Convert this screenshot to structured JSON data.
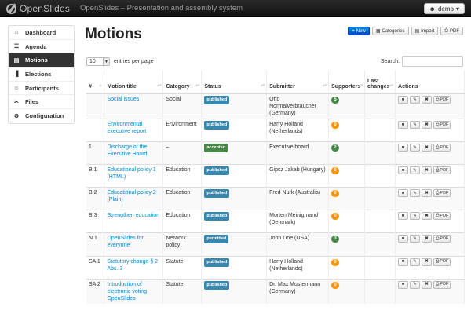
{
  "app": {
    "brand": "OpenSlides",
    "subtitle": "OpenSlides – Presentation and assembly system",
    "user": "demo"
  },
  "sidebar": {
    "items": [
      {
        "label": "Dashboard",
        "icon": "home-icon",
        "glyph": "⌂",
        "active": false
      },
      {
        "label": "Agenda",
        "icon": "list-icon",
        "glyph": "☰",
        "active": false
      },
      {
        "label": "Motions",
        "icon": "file-icon",
        "glyph": "▤",
        "active": true
      },
      {
        "label": "Elections",
        "icon": "bar-chart-icon",
        "glyph": "▐",
        "active": false
      },
      {
        "label": "Participants",
        "icon": "user-icon",
        "glyph": "☺",
        "active": false
      },
      {
        "label": "Files",
        "icon": "paperclip-icon",
        "glyph": "✂",
        "active": false
      },
      {
        "label": "Configuration",
        "icon": "gear-icon",
        "glyph": "⚙",
        "active": false
      }
    ]
  },
  "main": {
    "title": "Motions",
    "toolbar": {
      "new": "New",
      "categories": "Categories",
      "import": "Import",
      "pdf": "PDF"
    },
    "length": {
      "value": "10",
      "label": "entries per page"
    },
    "search": {
      "label": "Search:",
      "value": ""
    },
    "columns": [
      "#",
      "Motion title",
      "Category",
      "Status",
      "Submitter",
      "Supporters",
      "Last changes",
      "Actions"
    ],
    "rows": [
      {
        "num": "",
        "title": "Social issues",
        "category": "Social",
        "status": "published",
        "submitter": "Otto Normalverbraucher (Germany)",
        "supporters": "5",
        "sup_color": "green"
      },
      {
        "num": "",
        "title": "Environmental executive report",
        "category": "Environment",
        "status": "published",
        "submitter": "Harry Holland (Netherlands)",
        "supporters": "0",
        "sup_color": "orange"
      },
      {
        "num": "1",
        "title": "Discharge of the Executive Board",
        "category": "–",
        "status": "accepted",
        "submitter": "Executive board",
        "supporters": "2",
        "sup_color": "green"
      },
      {
        "num": "B 1",
        "title": "Educational policy 1 (HTML)",
        "category": "Education",
        "status": "published",
        "submitter": "Gipsz Jakab (Hungary)",
        "supporters": "0",
        "sup_color": "orange"
      },
      {
        "num": "B 2",
        "title": "Educational policy 2 (Plain)",
        "category": "Education",
        "status": "published",
        "submitter": "Fred Nurk (Australia)",
        "supporters": "0",
        "sup_color": "orange"
      },
      {
        "num": "B 3",
        "title": "Strengthen education",
        "category": "Education",
        "status": "published",
        "submitter": "Morten Meinigmand (Denmark)",
        "supporters": "0",
        "sup_color": "orange"
      },
      {
        "num": "N 1",
        "title": "OpenSlides for everyone",
        "category": "Network policy",
        "status": "permitted",
        "submitter": "John Doe (USA)",
        "supporters": "3",
        "sup_color": "green"
      },
      {
        "num": "SA 1",
        "title": "Statutory change § 2 Abs. 3",
        "category": "Statute",
        "status": "published",
        "submitter": "Harry Holland (Netherlands)",
        "supporters": "0",
        "sup_color": "orange"
      },
      {
        "num": "SA 2",
        "title": "Introduction of electronic voting OpenSlides",
        "category": "Statute",
        "status": "published",
        "submitter": "Dr. Max Mustermann (Germany)",
        "supporters": "0",
        "sup_color": "orange"
      }
    ],
    "action_pdf": "PDF"
  }
}
